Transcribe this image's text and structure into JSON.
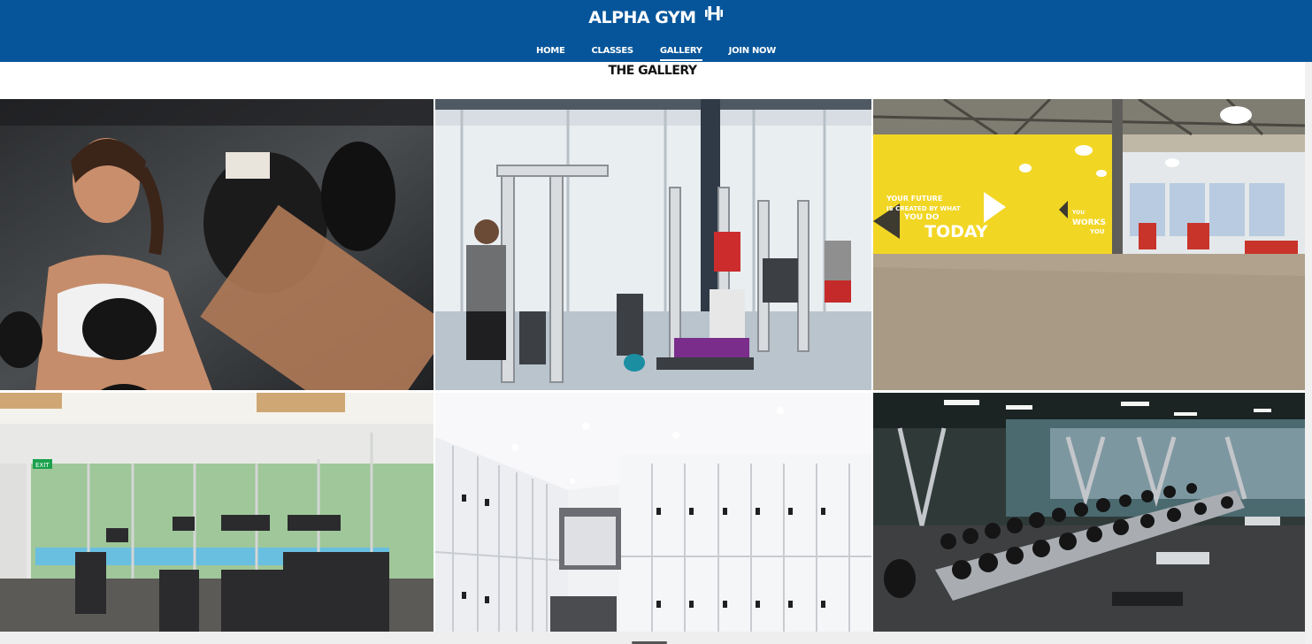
{
  "header": {
    "logo_text": "ALPHA GYM",
    "logo_icon": "dumbbell-icon",
    "background": "#06559a"
  },
  "nav": {
    "items": [
      {
        "label": "HOME"
      },
      {
        "label": "CLASSES"
      },
      {
        "label": "GALLERY",
        "active": true
      },
      {
        "label": "JOIN NOW"
      }
    ]
  },
  "gallery": {
    "title": "THE GALLERY",
    "images": [
      {
        "name": "boxing-training-photo"
      },
      {
        "name": "cable-machine-area-photo"
      },
      {
        "name": "studio-hall-photo",
        "wall_text": [
          "YOUR FUTURE",
          "IS CREATED BY WHAT",
          "YOU DO",
          "TODAY",
          "YOU",
          "WORKS",
          "YOU"
        ]
      },
      {
        "name": "treadmill-room-photo",
        "sign_text": "EXIT"
      },
      {
        "name": "locker-room-photo"
      },
      {
        "name": "dumbbell-rack-photo"
      }
    ]
  }
}
